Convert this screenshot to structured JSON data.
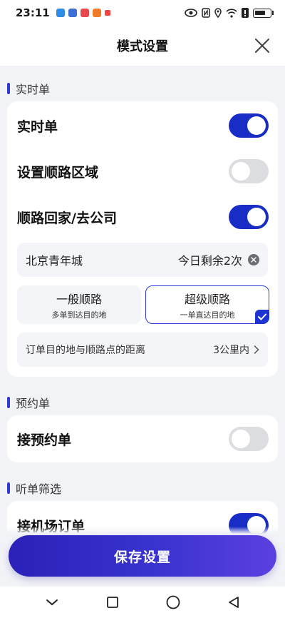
{
  "status": {
    "time": "23:11"
  },
  "header": {
    "title": "模式设置"
  },
  "sections": {
    "realtime": {
      "label": "实时单",
      "rows": {
        "realtime_order": {
          "label": "实时单",
          "on": true
        },
        "route_area": {
          "label": "设置顺路区域",
          "on": false
        },
        "route_home": {
          "label": "顺路回家/去公司",
          "on": true
        }
      },
      "address": {
        "name": "北京青年城",
        "remaining": "今日剩余2次"
      },
      "options": {
        "normal": {
          "title": "一般顺路",
          "subtitle": "多单到达目的地",
          "selected": false
        },
        "super": {
          "title": "超级顺路",
          "subtitle": "一单直达目的地",
          "selected": true
        }
      },
      "distance": {
        "label": "订单目的地与顺路点的距离",
        "value": "3公里内"
      }
    },
    "reservation": {
      "label": "预约单",
      "rows": {
        "accept_reservation": {
          "label": "接预约单",
          "on": false
        }
      }
    },
    "filter": {
      "label": "听单筛选",
      "rows": {
        "airport": {
          "label": "接机场订单",
          "on": true
        }
      }
    }
  },
  "footer": {
    "save_label": "保存设置"
  },
  "colors": {
    "accent": "#1a2cc6",
    "background": "#f2f3f7"
  }
}
